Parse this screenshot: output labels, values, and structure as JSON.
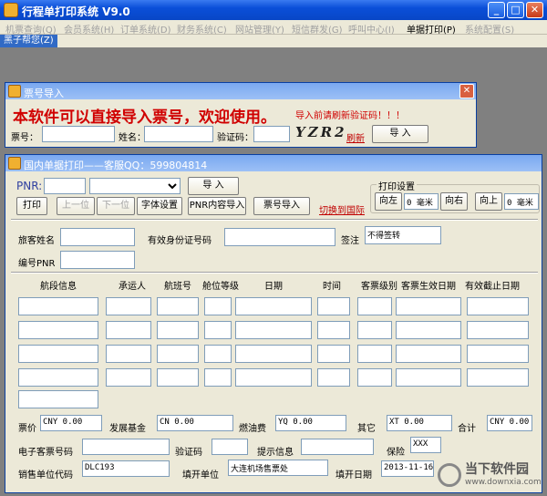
{
  "window": {
    "title": "行程单打印系统 V9.0",
    "min": "_",
    "max": "□",
    "close": "✕"
  },
  "menu": {
    "items": [
      {
        "label": "机票查询(Q)",
        "enabled": false
      },
      {
        "label": "会员系统(H)",
        "enabled": false
      },
      {
        "label": "订单系统(D)",
        "enabled": false
      },
      {
        "label": "财务系统(C)",
        "enabled": false
      },
      {
        "label": "网站管理(Y)",
        "enabled": false
      },
      {
        "label": "短信群发(G)",
        "enabled": false
      },
      {
        "label": "呼叫中心(I)",
        "enabled": false
      },
      {
        "label": "单据打印(P)",
        "enabled": true
      },
      {
        "label": "系统配置(S)",
        "enabled": false
      }
    ],
    "help": "黑子帮您(Z)"
  },
  "import_win": {
    "title": "票号导入",
    "banner": "本软件可以直接导入票号，欢迎使用。",
    "warn": "导入前请刷新验证码！！！",
    "ticket_label": "票号：",
    "name_label": "姓名：",
    "captcha_label": "验证码：",
    "captcha_text": "YZR2",
    "refresh": "刷新",
    "import_btn": "导 入"
  },
  "print_win": {
    "title": "国内单据打印——客服QQ：599804814",
    "pnr_label": "PNR:",
    "import_btn": "导 入",
    "print_btn": "打印",
    "prev_btn": "上一位",
    "next_btn": "下一位",
    "font_btn": "字体设置",
    "pnr_import_btn": "PNR内容导入",
    "ticket_import_btn": "票号导入",
    "switch_link": "切换到国际",
    "print_settings": {
      "label": "打印设置",
      "left_btn": "向左",
      "left_val": "0",
      "left_unit": "毫米",
      "right_btn": "向右",
      "up_btn": "向上",
      "up_val": "0",
      "up_unit": "毫米"
    },
    "passenger_label": "旅客姓名",
    "id_label": "有效身份证号码",
    "endorse_label": "签注",
    "endorse_val": "不得签转",
    "pnr_code_label": "编号PNR",
    "columns": [
      "航段信息",
      "承运人",
      "航班号",
      "舱位等级",
      "日期",
      "时间",
      "客票级别",
      "客票生效日期",
      "有效截止日期"
    ],
    "fare_label": "票价",
    "fare_val": "CNY 0.00",
    "fund_label": "发展基金",
    "fund_val": "CN 0.00",
    "fuel_label": "燃油费",
    "fuel_val": "YQ 0.00",
    "other_label": "其它",
    "other_val": "XT 0.00",
    "total_label": "合计",
    "total_val": "CNY 0.00",
    "eticket_label": "电子客票号码",
    "verify_label": "验证码",
    "hint_label": "提示信息",
    "insurance_label": "保险",
    "insurance_val": "XXX",
    "agent_code_label": "销售单位代码",
    "agent_code_val": "DLC193",
    "issuer_label": "填开单位",
    "issuer_val": "大连机场售票处",
    "issue_date_label": "填开日期",
    "issue_date_val": "2013-11-16"
  },
  "watermark": {
    "name": "当下软件园",
    "url": "www.downxia.com"
  }
}
